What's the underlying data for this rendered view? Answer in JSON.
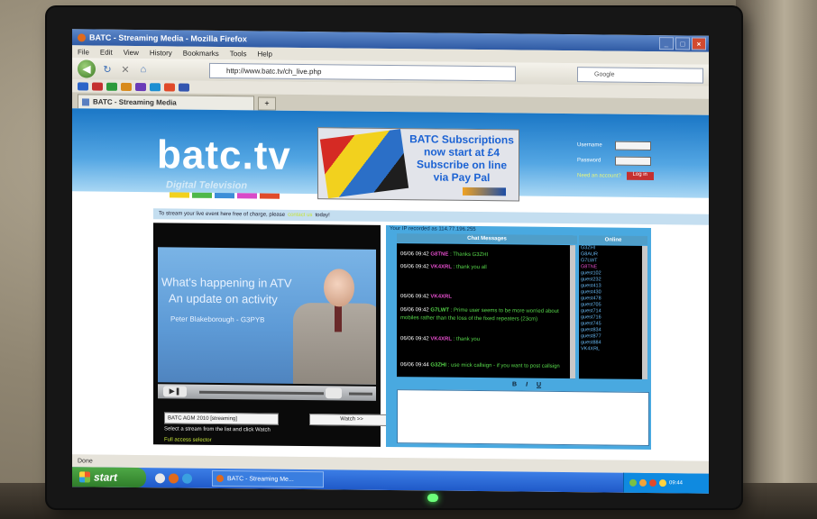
{
  "browser": {
    "window_title": "BATC - Streaming Media - Mozilla Firefox",
    "menu": [
      "File",
      "Edit",
      "View",
      "History",
      "Bookmarks",
      "Tools",
      "Help"
    ],
    "url": "http://www.batc.tv/ch_live.php",
    "search_placeholder": "Google",
    "tab_label": "BATC - Streaming Media",
    "tab_new": "+",
    "status": "Done"
  },
  "site": {
    "logo": "batc.tv",
    "logo_sub": "Digital Television",
    "ad": {
      "line1": "BATC Subscriptions",
      "line2": "now start at £4",
      "line3": "Subscribe on line",
      "line4": "via Pay Pal"
    },
    "login": {
      "username_label": "Username",
      "password_label": "Password",
      "forgot": "Need an account?",
      "button": "Log in"
    },
    "notice": {
      "prefix": "To stream your live event here free of charge, please",
      "link": "contact us",
      "suffix": "today!"
    }
  },
  "player": {
    "video_line1": "What's happening in ATV",
    "video_line2": "An update on activity",
    "video_line3": "Peter Blakeborough - G3PYB",
    "stream_selected": "BATC AGM 2010 [streaming]",
    "watch_button": "Watch >>",
    "hint": "Select a stream from the list and click Watch",
    "full_access": "Full access selector"
  },
  "chat": {
    "ip_line": "Your IP recorded as 114.77.196.255",
    "messages_header": "Chat Messages",
    "online_header": "Online",
    "messages": [
      {
        "time": "06/06 09:42",
        "call": "G8TNE",
        "call_color": "pink",
        "text": ": Thanks G3ZHI"
      },
      {
        "time": "06/06 09:42",
        "call": "VK4XRL",
        "call_color": "pink",
        "text": ": thank you all"
      },
      {
        "time": "06/06 09:42",
        "call": "VK4XRL",
        "call_color": "pink",
        "text": ""
      },
      {
        "time": "06/06 09:42",
        "call": "G7LWT",
        "call_color": "green",
        "text": ": Prime user seems to be more worried about mobiles rather than the loss of the fixed repeaters (23cm)"
      },
      {
        "time": "06/06 09:42",
        "call": "VK4XRL",
        "call_color": "pink",
        "text": ": thank you"
      },
      {
        "time": "06/06 09:44",
        "call": "G3ZHI",
        "call_color": "green",
        "text": ": use mick callsign - if you want to post callsign"
      }
    ],
    "online": [
      "G3ZHI",
      "G8AUR",
      "G7LWT",
      "G8TNE",
      "guest102",
      "guest232",
      "guest413",
      "guest430",
      "guest478",
      "guest705",
      "guest714",
      "guest716",
      "guest745",
      "guest834",
      "guest877",
      "guest884",
      "VK4XRL"
    ],
    "online_highlight": "G8TNE",
    "format_bold": "B",
    "format_italic": "I",
    "format_underline": "U"
  },
  "taskbar": {
    "start": "start",
    "task_item": "BATC - Streaming Me...",
    "clock": "09:44"
  }
}
